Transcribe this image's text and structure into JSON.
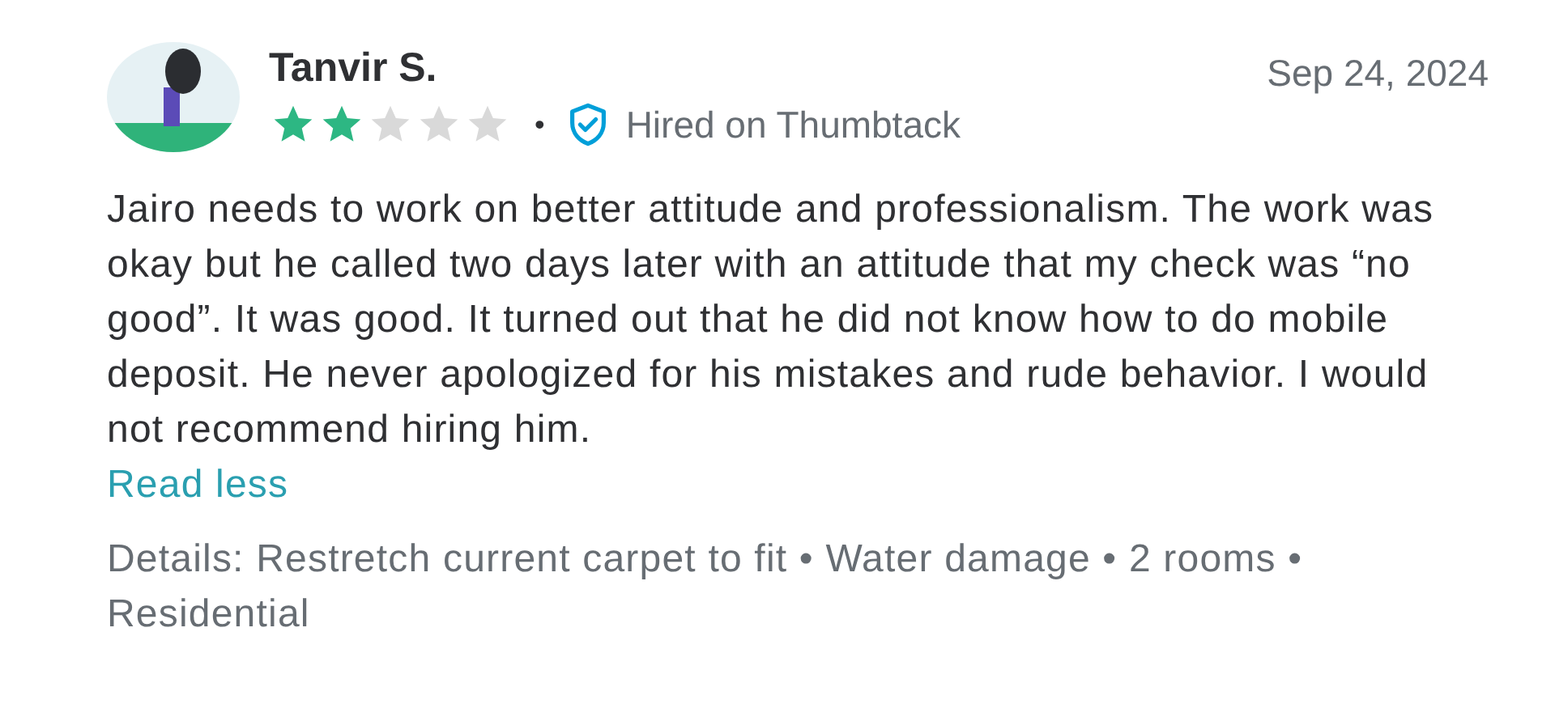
{
  "review": {
    "reviewer": "Tanvir S.",
    "stars": 2,
    "separator": "•",
    "badge": "Hired on Thumbtack",
    "date": "Sep 24, 2024",
    "body": "Jairo needs to work on better attitude and professionalism. The work was okay but he called two days later with an attitude that my check was “no good”. It was good. It turned out that he did not know how to do mobile deposit. He never apologized for his mistakes and rude behavior. I would not recommend hiring him.",
    "toggle_link": "Read less",
    "details": "Details: Restretch current carpet to fit • Water damage • 2 rooms • Residential"
  }
}
